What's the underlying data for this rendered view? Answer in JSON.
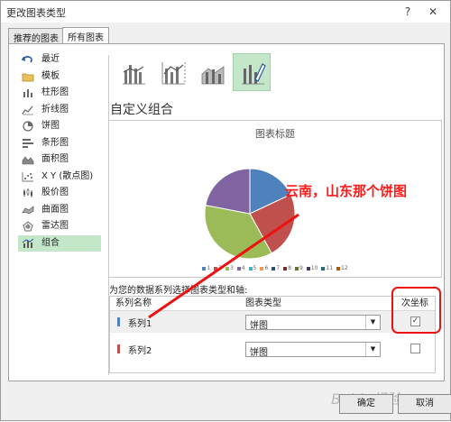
{
  "window": {
    "title": "更改图表类型",
    "help_icon": "?",
    "close_icon": "✕"
  },
  "tabs": [
    {
      "label": "推荐的图表",
      "active": false
    },
    {
      "label": "所有图表",
      "active": true
    }
  ],
  "left_list": {
    "items": [
      {
        "label": "最近",
        "icon": "undo-icon"
      },
      {
        "label": "模板",
        "icon": "folder-icon"
      },
      {
        "label": "柱形图",
        "icon": "column-chart-icon"
      },
      {
        "label": "折线图",
        "icon": "line-chart-icon"
      },
      {
        "label": "饼图",
        "icon": "pie-chart-icon"
      },
      {
        "label": "条形图",
        "icon": "bar-chart-icon"
      },
      {
        "label": "面积图",
        "icon": "area-chart-icon"
      },
      {
        "label": "X Y (散点图)",
        "icon": "scatter-chart-icon"
      },
      {
        "label": "股价图",
        "icon": "stock-chart-icon"
      },
      {
        "label": "曲面图",
        "icon": "surface-chart-icon"
      },
      {
        "label": "雷达图",
        "icon": "radar-chart-icon"
      },
      {
        "label": "组合",
        "icon": "combo-chart-icon",
        "selected": true
      }
    ]
  },
  "combo": {
    "heading": "自定义组合",
    "subtype_icons": [
      "cluster-column-line-icon",
      "cluster-column-line-secondary-icon",
      "stacked-area-column-icon",
      "custom-combo-icon"
    ]
  },
  "preview": {
    "chart_title": "图表标题",
    "legend": [
      "1",
      "2",
      "3",
      "4",
      "5",
      "6",
      "7",
      "8",
      "9",
      "10",
      "11",
      "12"
    ]
  },
  "chart_data": {
    "type": "pie",
    "title": "图表标题",
    "categories": [
      "1",
      "2",
      "3",
      "4"
    ],
    "values": [
      18,
      24,
      36,
      22
    ],
    "colors": [
      "#4f81bd",
      "#c0504d",
      "#9bbb59",
      "#8064a2"
    ],
    "legend": [
      "1",
      "2",
      "3",
      "4",
      "5",
      "6",
      "7",
      "8",
      "9",
      "10",
      "11",
      "12"
    ],
    "legend_colors": [
      "#4f81bd",
      "#c0504d",
      "#9bbb59",
      "#8064a2",
      "#4bacc6",
      "#f79646",
      "#2c4d75",
      "#772c2a",
      "#5f7530",
      "#4d3b62",
      "#276a7c",
      "#b65708"
    ],
    "legend_position": "bottom"
  },
  "annotation": {
    "text": "云南，山东那个饼图",
    "color": "#ff1a1a"
  },
  "series_table": {
    "caption": "为您的数据系列选择图表类型和轴:",
    "headers": {
      "name": "系列名称",
      "type": "图表类型",
      "secondary": "次坐标轴"
    },
    "rows": [
      {
        "name": "系列1",
        "color": "#4f81bd",
        "type": "饼图",
        "secondary_axis": true,
        "check": "✓"
      },
      {
        "name": "系列2",
        "color": "#c0504d",
        "type": "饼图",
        "secondary_axis": false,
        "check": ""
      }
    ],
    "dropdown_arrow": "▼"
  },
  "buttons": {
    "ok": "确定",
    "cancel": "取消"
  },
  "watermark": "Baidu经验"
}
